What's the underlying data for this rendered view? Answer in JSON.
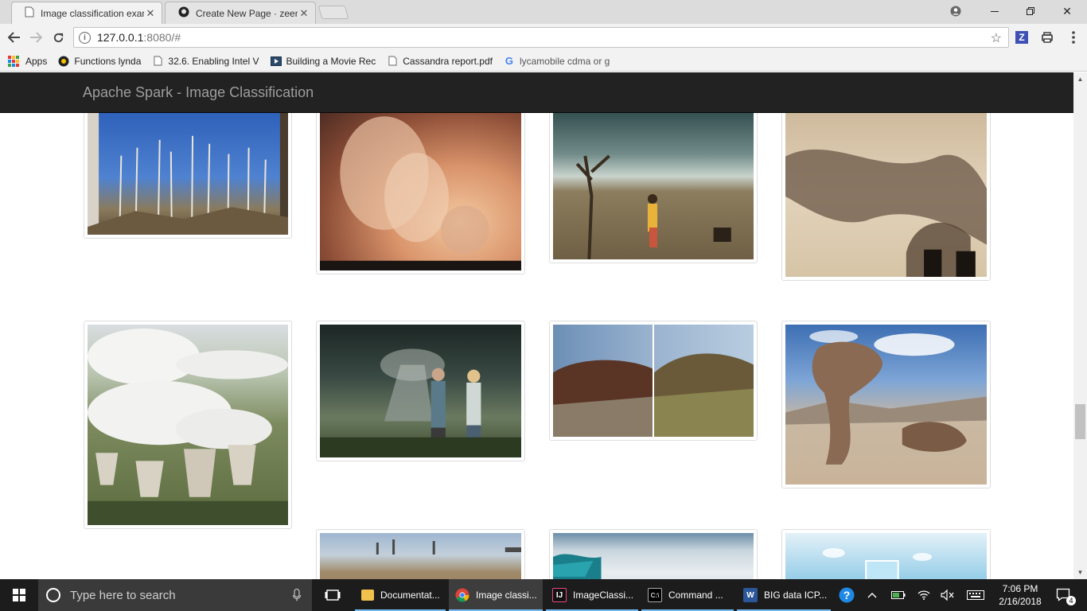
{
  "browser": {
    "tabs": [
      {
        "title": "Image classification exan",
        "icon": "page-icon",
        "active": true
      },
      {
        "title": "Create New Page · zeena",
        "icon": "github-icon",
        "active": false
      }
    ],
    "url_host": "127.0.0.1",
    "url_path": ":8080/#",
    "bookmarks": [
      {
        "label": "Apps",
        "icon": "apps-grid-icon"
      },
      {
        "label": "Functions lynda",
        "icon": "lynda-icon"
      },
      {
        "label": "32.6. Enabling Intel V",
        "icon": "page-icon"
      },
      {
        "label": "Building a Movie Rec",
        "icon": "video-icon"
      },
      {
        "label": "Cassandra report.pdf",
        "icon": "page-icon"
      },
      {
        "label": "lycamobile cdma or g",
        "icon": "google-icon"
      }
    ]
  },
  "page": {
    "brand": "Apache Spark - Image Classification",
    "images": [
      {
        "name": "dead-forest"
      },
      {
        "name": "power-plant-smoke-sunset"
      },
      {
        "name": "child-in-barren-land"
      },
      {
        "name": "smokestacks-sepia"
      },
      {
        "name": "cooling-towers-aerial"
      },
      {
        "name": "couple-with-gas-masks"
      },
      {
        "name": "eroded-soil-comparison"
      },
      {
        "name": "desert-rock-tree"
      },
      {
        "name": "industrial-landscape"
      },
      {
        "name": "melting-ice"
      },
      {
        "name": "ice-cube-water"
      }
    ]
  },
  "taskbar": {
    "search_placeholder": "Type here to search",
    "apps": [
      {
        "label": "Documentat...",
        "icon": "folder-icon"
      },
      {
        "label": "Image classi...",
        "icon": "chrome-icon"
      },
      {
        "label": "ImageClassi...",
        "icon": "intellij-icon"
      },
      {
        "label": "Command ...",
        "icon": "cmd-icon"
      },
      {
        "label": "BIG data ICP...",
        "icon": "word-icon"
      }
    ],
    "time": "7:06 PM",
    "date": "2/16/2018",
    "notifications": "4"
  }
}
